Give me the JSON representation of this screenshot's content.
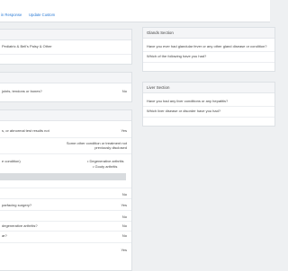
{
  "topbar": {
    "links": [
      "in Response",
      "Update Custom"
    ]
  },
  "left": {
    "panel1": {
      "row": "Pediatric & Bell's Palsy & Other"
    },
    "panel2": {
      "q": "joints, tendons or bones?",
      "a": "No"
    },
    "panel3": {
      "q1": "s, or abnormal test results not",
      "a1": "Yes",
      "other_line1": "Some other condition or treatment not",
      "other_line2": "previously disclosed",
      "cond_left": "e condition)",
      "cond_items": [
        "• Degenerative arthritis",
        "• Gouty arthritis"
      ],
      "rows": [
        {
          "q": "",
          "a": "No"
        },
        {
          "q": "parfacing surgery?",
          "a": "Yes"
        },
        {
          "q": "",
          "a": "No"
        },
        {
          "q": "degenerative arthritis?",
          "a": "No"
        },
        {
          "q": "ar?",
          "a": "No"
        },
        {
          "q": "",
          "a": "Yes"
        }
      ]
    }
  },
  "right": {
    "glands": {
      "title": "Glands Section",
      "q1": "Have you ever had glandular fever or any other gland disease or condition?",
      "q2": "Which of the following have you had?"
    },
    "liver": {
      "title": "Liver Section",
      "q1": "Have you had any liver conditions or any hepatitis?",
      "q2": "Which liver disease or disorder have you had?"
    }
  }
}
